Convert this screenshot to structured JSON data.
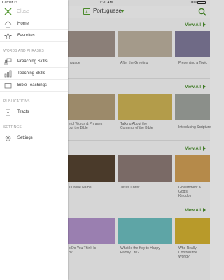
{
  "status_bar": {
    "carrier": "Carrier",
    "time": "11:20 AM",
    "battery": "100%"
  },
  "header": {
    "language_code": "A",
    "language": "Portuguese"
  },
  "drawer": {
    "close_label": "Close",
    "items_top": [
      {
        "label": "Home",
        "icon": "home-icon"
      },
      {
        "label": "Favorites",
        "icon": "star-icon"
      }
    ],
    "section_words": "WORDS AND PHRASES",
    "items_words": [
      {
        "label": "Preaching Skills",
        "icon": "presentation-icon"
      },
      {
        "label": "Teaching Skills",
        "icon": "bar-chart-icon"
      },
      {
        "label": "Bible Teachings",
        "icon": "book-icon"
      }
    ],
    "section_publications": "PUBLICATIONS",
    "items_publications": [
      {
        "label": "Tracts",
        "icon": "tract-icon"
      }
    ],
    "section_settings": "SETTINGS",
    "items_settings": [
      {
        "label": "Settings",
        "icon": "gear-icon"
      }
    ]
  },
  "main": {
    "view_all": "View All",
    "sections": [
      {
        "captions": [
          "nguage",
          "After the Greeting",
          "Presenting a Topic"
        ]
      },
      {
        "captions": [
          "eful Words & Phrases\nout the Bible",
          "Talking About the\nContents of the Bible",
          "Introducing Scripture"
        ]
      },
      {
        "captions": [
          "s Divine Name",
          "Jesus Christ",
          "Government & God's\nKingdom"
        ]
      },
      {
        "captions": [
          "o Do You Think Is\nd?",
          "What Is the Key to Happy\nFamily Life?",
          "Who Really Controls the\nWorld?"
        ]
      }
    ],
    "thumb_colors": [
      "#8b7f78",
      "#a49a8a",
      "#6f6a86",
      "#9c8a6a",
      "#b39c4a",
      "#8b8f8a",
      "#4a3a2a",
      "#7a6a66",
      "#b58a4a",
      "#9a7fb0",
      "#5ea5a6",
      "#b89a2a"
    ]
  }
}
